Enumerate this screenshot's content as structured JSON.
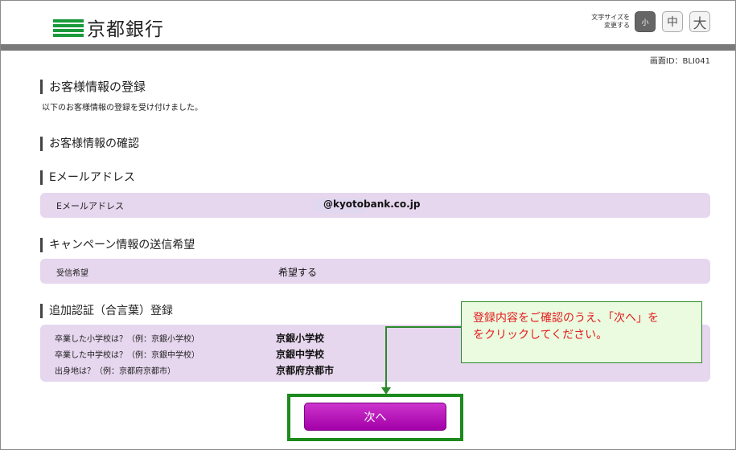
{
  "header": {
    "logo_text": "京都銀行",
    "font_size_label_1": "文字サイズを",
    "font_size_label_2": "変更する",
    "size_small": "小",
    "size_medium": "中",
    "size_large": "大",
    "brand_color": "#1a9a3a"
  },
  "screen_id": "画面ID：BLI041",
  "page": {
    "title": "お客様情報の登録",
    "description": "以下のお客様情報の登録を受け付けました。"
  },
  "sections": {
    "confirm_heading": "お客様情報の確認",
    "email": {
      "heading": "Eメールアドレス",
      "label": "Eメールアドレス",
      "value": "@kyotobank.co.jp"
    },
    "campaign": {
      "heading": "キャンペーン情報の送信希望",
      "label": "受信希望",
      "value": "希望する"
    },
    "security": {
      "heading": "追加認証（合言葉）登録",
      "rows": [
        {
          "question": "卒業した小学校は？（例：京銀小学校）",
          "answer": "京銀小学校"
        },
        {
          "question": "卒業した中学校は？（例：京銀中学校）",
          "answer": "京銀中学校"
        },
        {
          "question": "出身地は？（例：京都府京都市）",
          "answer": "京都府京都市"
        }
      ]
    }
  },
  "callout": {
    "line1": "登録内容をご確認のうえ、「次へ」を",
    "line2": "をクリックしてください。"
  },
  "next_button": "次へ",
  "colors": {
    "panel": "#e6d6ee",
    "button": "#b30fb8",
    "callout_text": "#e41b1b",
    "callout_border": "#2a8a2a"
  }
}
